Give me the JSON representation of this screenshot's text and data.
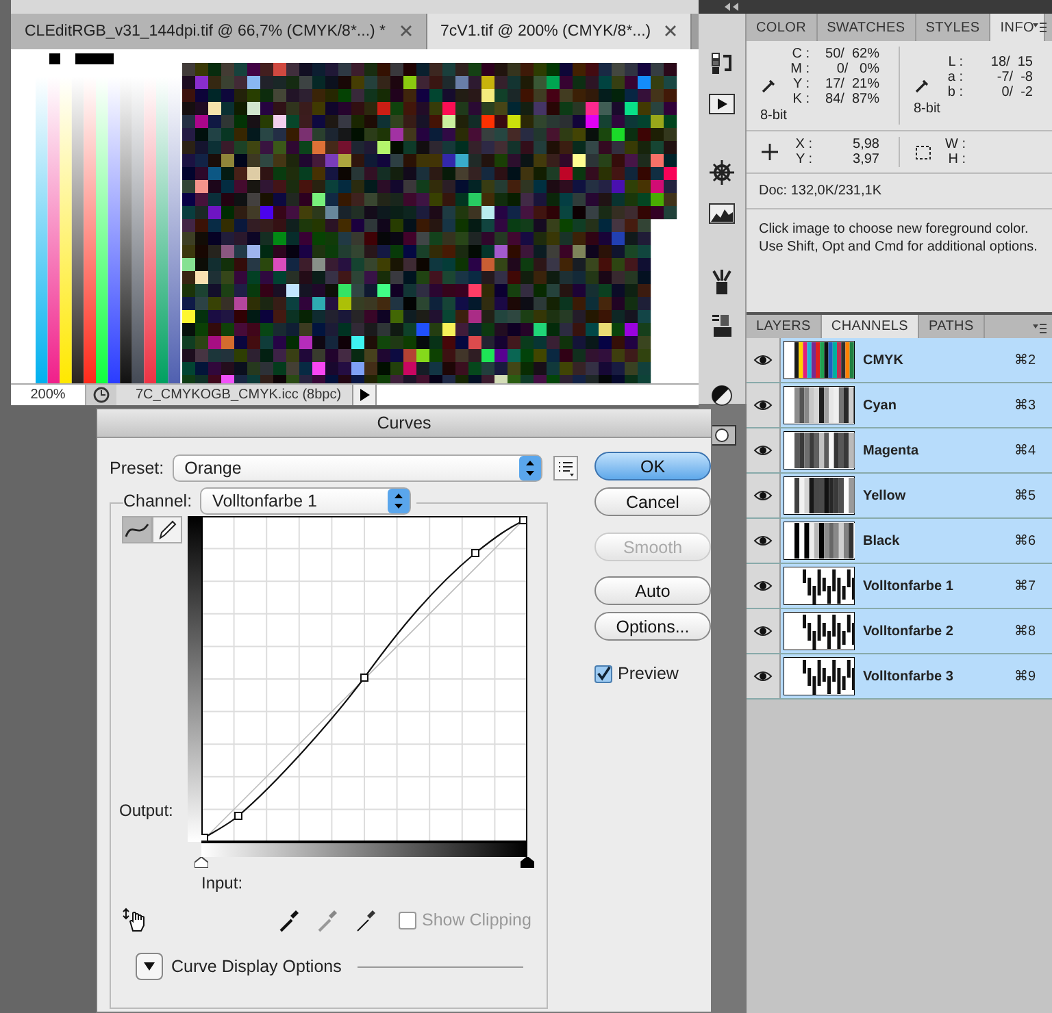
{
  "document": {
    "tabs": [
      {
        "label": "CLEditRGB_v31_144dpi.tif @ 66,7% (CMYK/8*...) *",
        "selected": false
      },
      {
        "label": "7cV1.tif @ 200% (CMYK/8*...)",
        "selected": true
      }
    ],
    "zoom": "200%",
    "profile": "7C_CMYKOGB_CMYK.icc (8bpc)"
  },
  "info_panel": {
    "tabs": [
      {
        "label": "COLOR",
        "selected": false
      },
      {
        "label": "SWATCHES",
        "selected": false
      },
      {
        "label": "STYLES",
        "selected": false
      },
      {
        "label": "INFO",
        "selected": true
      }
    ],
    "cmyk": {
      "rows": [
        {
          "label": "C :",
          "value": "50/  62%"
        },
        {
          "label": "M :",
          "value": "0/   0%"
        },
        {
          "label": "Y :",
          "value": "17/  21%"
        },
        {
          "label": "K :",
          "value": "84/  87%"
        }
      ],
      "bits": "8-bit"
    },
    "lab": {
      "rows": [
        {
          "label": "L :",
          "value": "18/  15"
        },
        {
          "label": "a :",
          "value": "-7/  -8"
        },
        {
          "label": "b :",
          "value": "0/  -2"
        }
      ],
      "bits": "8-bit"
    },
    "position": [
      {
        "label": "X :",
        "value": "5,98"
      },
      {
        "label": "Y :",
        "value": "3,97"
      }
    ],
    "size": [
      {
        "label": "W :"
      },
      {
        "label": "H :"
      }
    ],
    "doc": "Doc: 132,0K/231,1K",
    "hint": "Click image to choose new foreground color.  Use Shift, Opt and Cmd for additional options."
  },
  "channels_panel": {
    "tabs": [
      {
        "label": "LAYERS",
        "selected": false
      },
      {
        "label": "CHANNELS",
        "selected": true
      },
      {
        "label": "PATHS",
        "selected": false
      }
    ],
    "channels": [
      {
        "name": "CMYK",
        "shortcut": "⌘2",
        "kind": "composite",
        "visible": true,
        "selected": true
      },
      {
        "name": "Cyan",
        "shortcut": "⌘3",
        "kind": "plate",
        "visible": true,
        "selected": true
      },
      {
        "name": "Magenta",
        "shortcut": "⌘4",
        "kind": "plate",
        "visible": true,
        "selected": true
      },
      {
        "name": "Yellow",
        "shortcut": "⌘5",
        "kind": "plate",
        "visible": true,
        "selected": true
      },
      {
        "name": "Black",
        "shortcut": "⌘6",
        "kind": "plate",
        "visible": true,
        "selected": true
      },
      {
        "name": "Volltonfarbe 1",
        "shortcut": "⌘7",
        "kind": "spot",
        "visible": true,
        "selected": true
      },
      {
        "name": "Volltonfarbe 2",
        "shortcut": "⌘8",
        "kind": "spot",
        "visible": true,
        "selected": true
      },
      {
        "name": "Volltonfarbe 3",
        "shortcut": "⌘9",
        "kind": "spot",
        "visible": true,
        "selected": true
      }
    ]
  },
  "curves": {
    "title": "Curves",
    "preset_label": "Preset:",
    "preset": "Orange",
    "channel_label": "Channel:",
    "channel": "Volltonfarbe 1",
    "tools": [
      {
        "kind": "curve",
        "selected": true
      },
      {
        "kind": "pencil",
        "selected": false
      }
    ],
    "output_label": "Output:",
    "input_label": "Input:",
    "input_sliders": [
      {
        "kind": "light",
        "level": 0
      },
      {
        "kind": "dark",
        "level": 1
      }
    ],
    "buttons": [
      {
        "label": "OK",
        "kind": "default",
        "disabled": false
      },
      {
        "label": "Cancel",
        "kind": "normal",
        "disabled": false
      },
      {
        "label": "Smooth",
        "kind": "normal",
        "disabled": true
      },
      {
        "label": "Auto",
        "kind": "normal",
        "disabled": false
      },
      {
        "label": "Options...",
        "kind": "normal",
        "disabled": false
      }
    ],
    "preview": {
      "label": "Preview",
      "checked": true
    },
    "show_clipping": {
      "label": "Show Clipping",
      "checked": false,
      "disabled": true
    },
    "display_options": {
      "label": "Curve Display Options",
      "expanded": false
    }
  }
}
